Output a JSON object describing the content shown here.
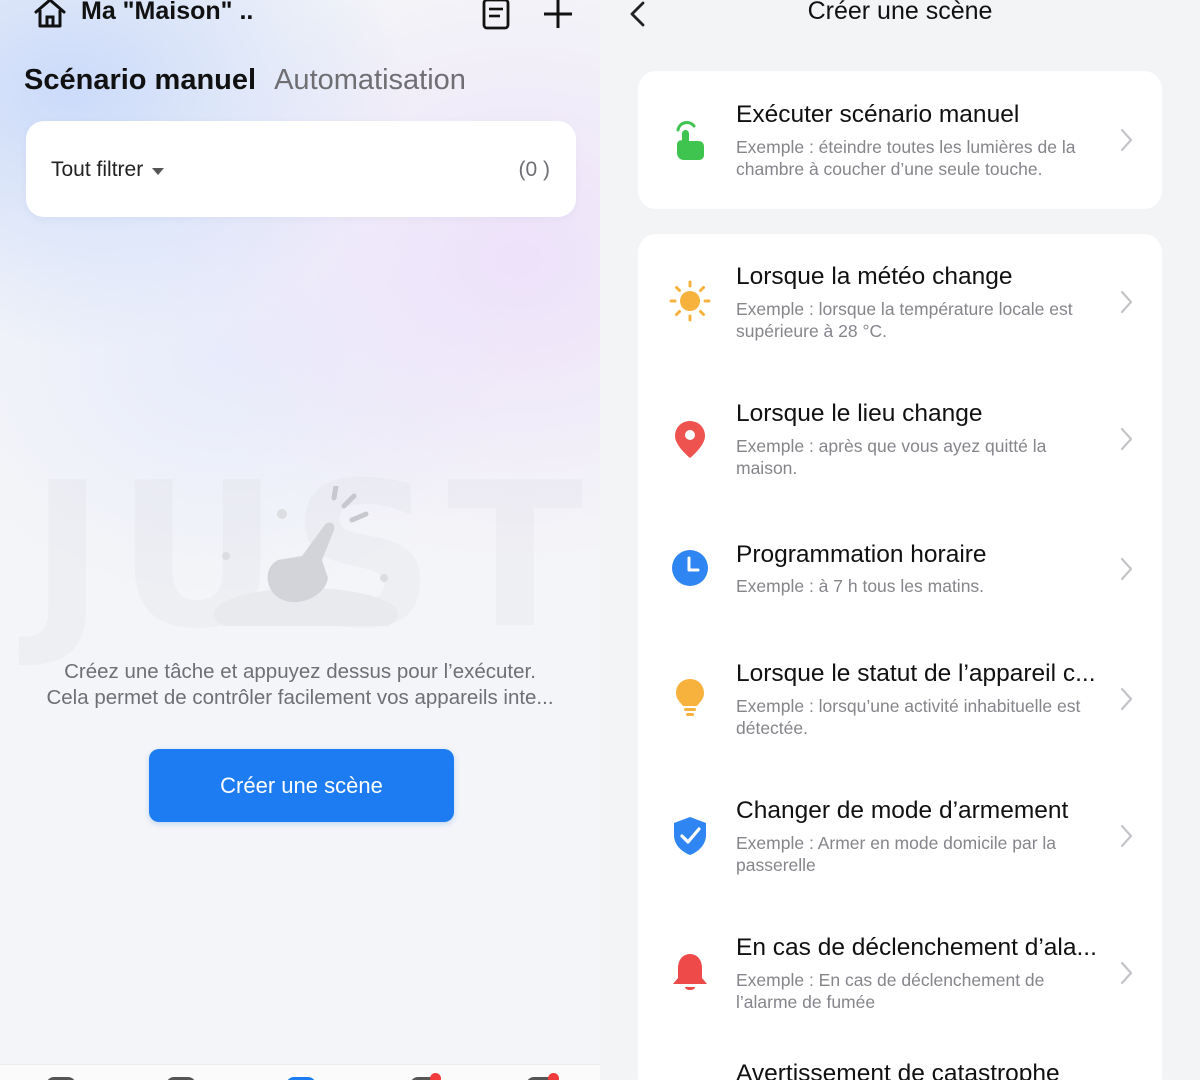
{
  "left": {
    "home_title": "Ma \"Maison\" ..",
    "tabs": {
      "active": "Scénario manuel",
      "inactive": "Automatisation"
    },
    "filter": {
      "label": "Tout filtrer",
      "count": "(0 )"
    },
    "empty_message": "Créez une tâche et appuyez dessus pour l’exécuter.\nCela permet de contrôler facilement vos appareils inte...",
    "create_button": "Créer une scène",
    "icons": {
      "home": "home-icon",
      "document": "document-icon",
      "add": "plus-icon"
    },
    "colors": {
      "accent": "#1e7cf2"
    }
  },
  "right": {
    "title": "Créer une scène",
    "items": [
      {
        "title": "Exécuter scénario manuel",
        "desc": "Exemple : éteindre toutes les lumières de la chambre à coucher d’une seule touche.",
        "icon": "hand-tap-icon",
        "color": "#3ec44f"
      },
      {
        "title": "Lorsque la météo change",
        "desc": "Exemple : lorsque la température locale est supérieure à 28 °C.",
        "icon": "sun-icon",
        "color": "#f6b23c"
      },
      {
        "title": "Lorsque le lieu change",
        "desc": "Exemple : après que vous ayez quitté la maison.",
        "icon": "location-pin-icon",
        "color": "#ef5350"
      },
      {
        "title": "Programmation horaire",
        "desc": "Exemple : à 7 h tous les matins.",
        "icon": "clock-icon",
        "color": "#2f86f2"
      },
      {
        "title": "Lorsque le statut de l’appareil c...",
        "desc": "Exemple : lorsqu’une activité inhabituelle est détectée.",
        "icon": "lightbulb-icon",
        "color": "#f6b23c"
      },
      {
        "title": "Changer de mode d’armement",
        "desc": "Exemple : Armer en mode domicile par la passerelle",
        "icon": "shield-check-icon",
        "color": "#2f86f2"
      },
      {
        "title": "En cas de déclenchement d’ala...",
        "desc": "Exemple : En cas de déclenchement de l’alarme de fumée",
        "icon": "bell-icon",
        "color": "#ef4a4a"
      },
      {
        "title": "Avertissement de catastrophe",
        "desc": "",
        "icon": "",
        "color": ""
      }
    ]
  }
}
